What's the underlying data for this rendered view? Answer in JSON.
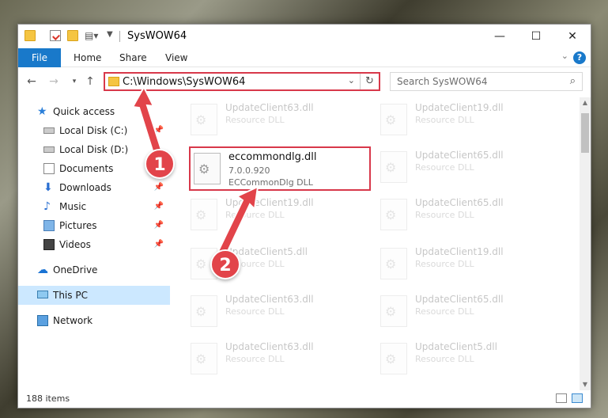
{
  "window": {
    "title": "SysWOW64",
    "controls": {
      "minimize": "—",
      "maximize": "☐",
      "close": "✕"
    }
  },
  "ribbon": {
    "tabs": [
      "File",
      "Home",
      "Share",
      "View"
    ],
    "help": "?"
  },
  "address": {
    "path": "C:\\Windows\\SysWOW64",
    "search_placeholder": "Search SysWOW64"
  },
  "sidebar": {
    "items": [
      {
        "label": "Quick access",
        "icon": "star-icon",
        "pinned": false
      },
      {
        "label": "Local Disk (C:)",
        "icon": "drive-icon",
        "pinned": true
      },
      {
        "label": "Local Disk (D:)",
        "icon": "drive-icon",
        "pinned": false
      },
      {
        "label": "Documents",
        "icon": "documents-icon",
        "pinned": true
      },
      {
        "label": "Downloads",
        "icon": "download-icon",
        "pinned": true
      },
      {
        "label": "Music",
        "icon": "music-icon",
        "pinned": true
      },
      {
        "label": "Pictures",
        "icon": "pictures-icon",
        "pinned": true
      },
      {
        "label": "Videos",
        "icon": "videos-icon",
        "pinned": true
      },
      {
        "label": "OneDrive",
        "icon": "cloud-icon",
        "pinned": false
      },
      {
        "label": "This PC",
        "icon": "pc-icon",
        "pinned": false,
        "selected": true
      },
      {
        "label": "Network",
        "icon": "network-icon",
        "pinned": false
      }
    ]
  },
  "files": {
    "left_column": [
      {
        "name": "UpdateClient63.dll",
        "desc": "Resource DLL"
      },
      {
        "name": "UpdateClient19.dll",
        "desc": "Resource DLL"
      },
      {
        "name": "UpdateClient5.dll",
        "desc": "Resource DLL"
      },
      {
        "name": "UpdateClient63.dll",
        "desc": "Resource DLL"
      },
      {
        "name": "UpdateClient63.dll",
        "desc": "Resource DLL"
      }
    ],
    "right_column": [
      {
        "name": "UpdateClient19.dll",
        "desc": "Resource DLL"
      },
      {
        "name": "UpdateClient65.dll",
        "desc": "Resource DLL"
      },
      {
        "name": "UpdateClient65.dll",
        "desc": "Resource DLL"
      },
      {
        "name": "UpdateClient19.dll",
        "desc": "Resource DLL"
      },
      {
        "name": "UpdateClient65.dll",
        "desc": "Resource DLL"
      },
      {
        "name": "UpdateClient5.dll",
        "desc": "Resource DLL"
      }
    ],
    "highlighted": {
      "name": "eccommondlg.dll",
      "version": "7.0.0.920",
      "desc": "ECCommonDlg DLL"
    }
  },
  "status": {
    "item_count": "188 items"
  },
  "annotations": {
    "step1": "1",
    "step2": "2",
    "color": "#e2444a"
  }
}
